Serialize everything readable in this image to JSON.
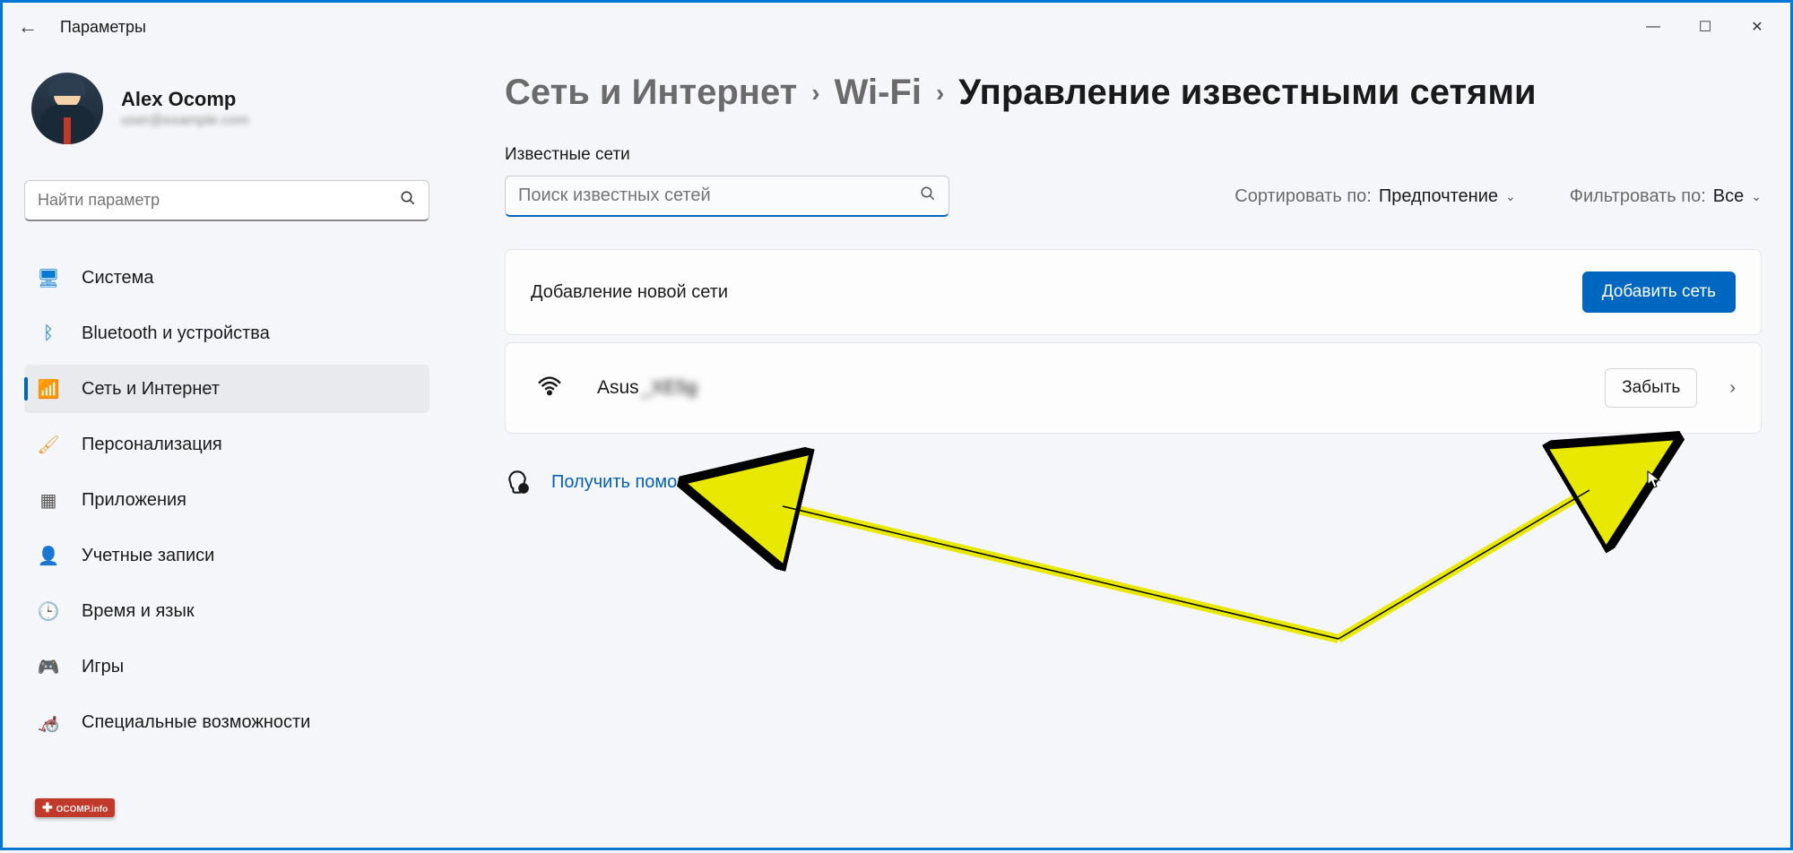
{
  "window": {
    "title": "Параметры",
    "min": "—",
    "max": "☐",
    "close": "✕"
  },
  "profile": {
    "name": "Alex Ocomp",
    "email": "user@example.com"
  },
  "sidebarSearch": {
    "placeholder": "Найти параметр"
  },
  "nav": {
    "items": [
      {
        "label": "Система",
        "iconColor": "#0078d4",
        "glyph": "🖥"
      },
      {
        "label": "Bluetooth и устройства",
        "iconColor": "#0078d4",
        "glyph": "ᛒ"
      },
      {
        "label": "Сеть и Интернет",
        "iconColor": "#0078d4",
        "glyph": "📶",
        "active": true
      },
      {
        "label": "Персонализация",
        "iconColor": "#e8a33d",
        "glyph": "🖌"
      },
      {
        "label": "Приложения",
        "iconColor": "#555",
        "glyph": "▦"
      },
      {
        "label": "Учетные записи",
        "iconColor": "#2a9d5c",
        "glyph": "👤"
      },
      {
        "label": "Время и язык",
        "iconColor": "#3f8fd8",
        "glyph": "🕒"
      },
      {
        "label": "Игры",
        "iconColor": "#7a7a7a",
        "glyph": "🎮"
      },
      {
        "label": "Специальные возможности",
        "iconColor": "#0078d4",
        "glyph": "🦽"
      }
    ]
  },
  "breadcrumb": {
    "parts": [
      "Сеть и Интернет",
      "Wi-Fi"
    ],
    "current": "Управление известными сетями"
  },
  "networks": {
    "sectionLabel": "Известные сети",
    "searchPlaceholder": "Поиск известных сетей",
    "sortLabel": "Сортировать по:",
    "sortValue": "Предпочтение",
    "filterLabel": "Фильтровать по:",
    "filterValue": "Все",
    "addCardTitle": "Добавление новой сети",
    "addButton": "Добавить сеть",
    "items": [
      {
        "name": "Asus",
        "suffix": "_XE5g",
        "forget": "Забыть"
      }
    ]
  },
  "help": {
    "text": "Получить помощь"
  },
  "watermark": "OCOMP.info"
}
